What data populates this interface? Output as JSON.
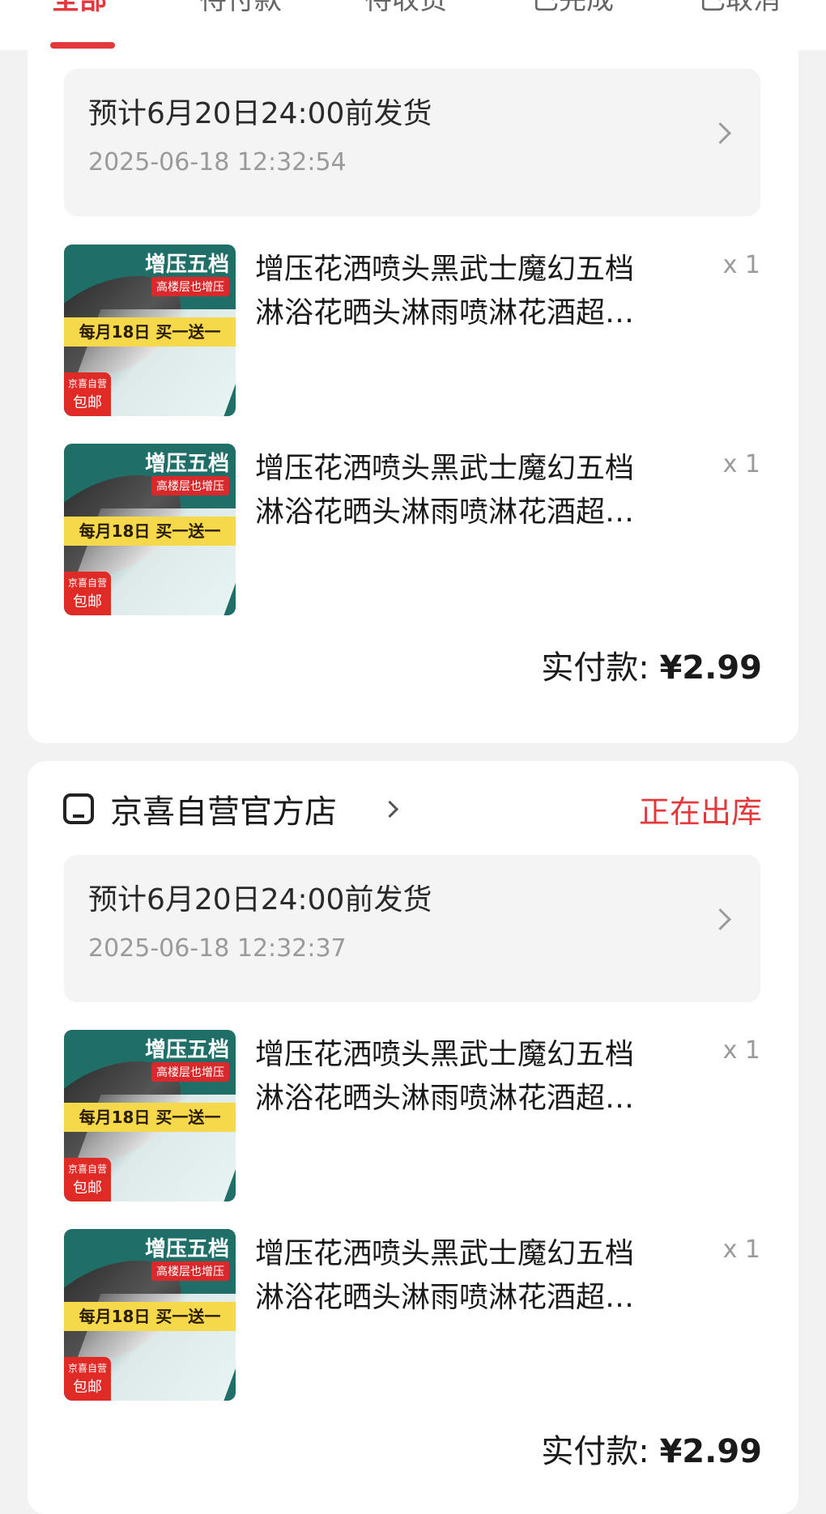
{
  "tabs": [
    {
      "label": "全部",
      "active": true
    },
    {
      "label": "待付款",
      "active": false
    },
    {
      "label": "待收货",
      "active": false
    },
    {
      "label": "已完成",
      "active": false
    },
    {
      "label": "已取消",
      "active": false
    }
  ],
  "orders": [
    {
      "shipping": {
        "text": "预计6月20日24:00前发货",
        "time": "2025-06-18 12:32:54"
      },
      "items": [
        {
          "title_line1": "增压花洒喷头黑武士魔幻五档",
          "title_line2": "淋浴花晒头淋雨喷淋花酒超…",
          "qty": "x 1"
        },
        {
          "title_line1": "增压花洒喷头黑武士魔幻五档",
          "title_line2": "淋浴花晒头淋雨喷淋花酒超…",
          "qty": "x 1"
        }
      ],
      "paid_label": "实付款:",
      "paid_amount": "¥2.99"
    },
    {
      "store": "京喜自营官方店",
      "status": "正在出库",
      "shipping": {
        "text": "预计6月20日24:00前发货",
        "time": "2025-06-18 12:32:37"
      },
      "items": [
        {
          "title_line1": "增压花洒喷头黑武士魔幻五档",
          "title_line2": "淋浴花晒头淋雨喷淋花酒超…",
          "qty": "x 1"
        },
        {
          "title_line1": "增压花洒喷头黑武士魔幻五档",
          "title_line2": "淋浴花晒头淋雨喷淋花酒超…",
          "qty": "x 1"
        }
      ],
      "paid_label": "实付款:",
      "paid_amount": "¥2.99"
    }
  ],
  "thumb": {
    "tag1": "增压五档",
    "tag2": "高楼层也增压",
    "band": "每月18日 买一送一",
    "badge_line1": "京喜自营",
    "badge_line2": "包邮"
  },
  "colors": {
    "accent": "#e4393c",
    "card": "#ffffff",
    "background": "#f2f2f2"
  }
}
